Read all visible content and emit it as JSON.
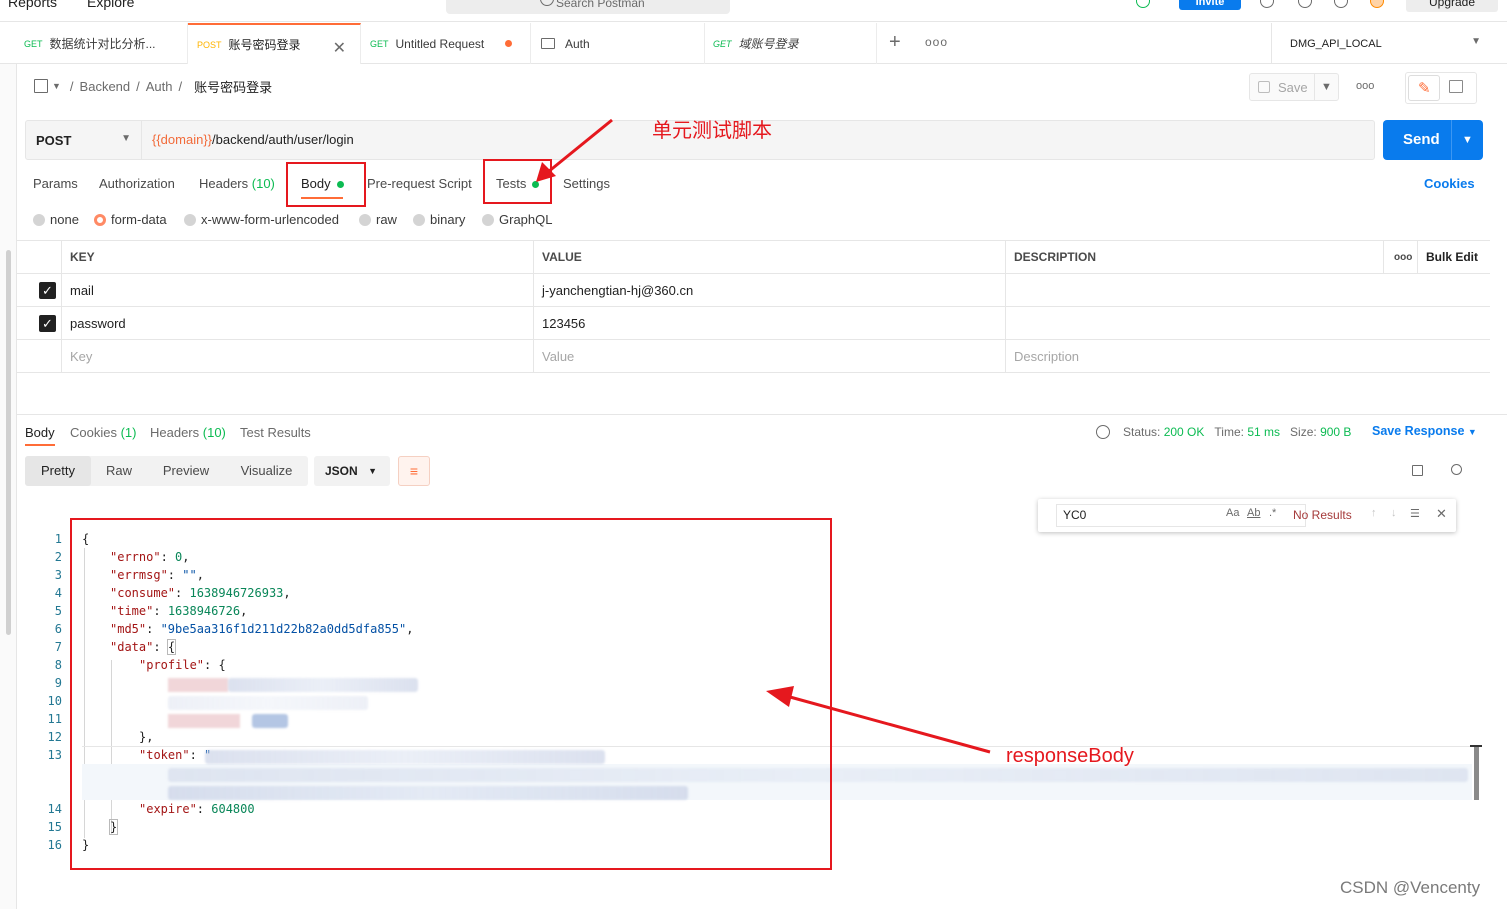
{
  "header": {
    "nav": [
      "Reports",
      "Explore"
    ],
    "search_placeholder": "Search Postman",
    "invite_label": "Invite",
    "upgrade_label": "Upgrade"
  },
  "tabs": [
    {
      "method": "GET",
      "label": "数据统计对比分析..."
    },
    {
      "method": "POST",
      "label": "账号密码登录"
    },
    {
      "method": "GET",
      "label": "Untitled Request"
    },
    {
      "method": "",
      "label": "Auth"
    },
    {
      "method": "GET",
      "label": "域账号登录"
    }
  ],
  "environment": "DMG_API_LOCAL",
  "breadcrumb": {
    "parts": [
      "Backend",
      "Auth"
    ],
    "current": "账号密码登录"
  },
  "save_label": "Save",
  "request": {
    "method": "POST",
    "url_var": "{{domain}}",
    "url_path": "/backend/auth/user/login",
    "send_label": "Send"
  },
  "request_tabs": [
    "Params",
    "Authorization",
    "Headers",
    "(10)",
    "Body",
    "Pre-request Script",
    "Tests",
    "Settings"
  ],
  "cookies_label": "Cookies",
  "body_types": [
    "none",
    "form-data",
    "x-www-form-urlencoded",
    "raw",
    "binary",
    "GraphQL"
  ],
  "form": {
    "headers": [
      "KEY",
      "VALUE",
      "DESCRIPTION"
    ],
    "bulk_edit": "Bulk Edit",
    "rows": [
      {
        "key": "mail",
        "value": "j-yanchengtian-hj@360.cn",
        "checked": true
      },
      {
        "key": "password",
        "value": "123456",
        "checked": true
      }
    ],
    "placeholders": {
      "key": "Key",
      "value": "Value",
      "description": "Description"
    }
  },
  "response": {
    "tabs": [
      "Body",
      "Cookies",
      "(1)",
      "Headers",
      "(10)",
      "Test Results"
    ],
    "status_label": "Status:",
    "status_value": "200 OK",
    "time_label": "Time:",
    "time_value": "51 ms",
    "size_label": "Size:",
    "size_value": "900 B",
    "save_response": "Save Response",
    "view_modes": [
      "Pretty",
      "Raw",
      "Preview",
      "Visualize"
    ],
    "format": "JSON",
    "find": {
      "query": "YC0",
      "aa": "Aa",
      "ab": "Ab",
      "regex": ".*",
      "result": "No Results"
    },
    "lines": {
      "l2_key": "\"errno\"",
      "l2_val": "0",
      "l3_key": "\"errmsg\"",
      "l3_val": "\"\"",
      "l4_key": "\"consume\"",
      "l4_val": "1638946726933",
      "l5_key": "\"time\"",
      "l5_val": "1638946726",
      "l6_key": "\"md5\"",
      "l6_val": "\"9be5aa316f1d211d22b82a0dd5dfa855\"",
      "l7_key": "\"data\"",
      "l8_key": "\"profile\"",
      "l13_key": "\"token\"",
      "l14_key": "\"expire\"",
      "l14_val": "604800"
    }
  },
  "annotations": {
    "tests_note": "单元测试脚本",
    "body_note": "responseBody"
  },
  "watermark": "CSDN @Vencenty",
  "colors": {
    "accent": "#ff6c37",
    "send": "#097bed",
    "green": "#0cbb52",
    "annotation": "#e5181e"
  }
}
